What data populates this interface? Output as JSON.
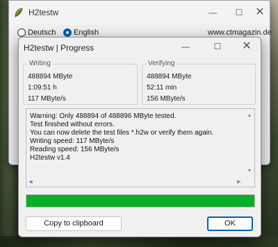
{
  "main_window": {
    "title": "H2testw",
    "languages": [
      "Deutsch",
      "English"
    ],
    "selected_language": "English",
    "website": "www.ctmagazin.de",
    "minimize_symbol": "—",
    "maximize_symbol": "☐",
    "close_symbol": "✕"
  },
  "dialog": {
    "title": "H2testw | Progress",
    "minimize_symbol": "—",
    "maximize_symbol": "☐",
    "close_symbol": "✕",
    "writing": {
      "label": "Writing",
      "size": "488894 MByte",
      "time": "1:09:51 h",
      "speed": "117 MByte/s"
    },
    "verifying": {
      "label": "Verifying",
      "size": "488894 MByte",
      "time": "52:11 min",
      "speed": "156 MByte/s"
    },
    "log_lines": [
      "Warning: Only 488894 of 488896 MByte tested.",
      "Test finished without errors.",
      "You can now delete the test files *.h2w or verify them again.",
      "Writing speed: 117 MByte/s",
      "Reading speed: 156 MByte/s",
      "H2testw v1.4"
    ],
    "progress_fraction": 1.0,
    "progress_color": "#06b025",
    "copy_button": "Copy to clipboard",
    "ok_button": "OK"
  },
  "colors": {
    "accent": "#005fb8"
  }
}
